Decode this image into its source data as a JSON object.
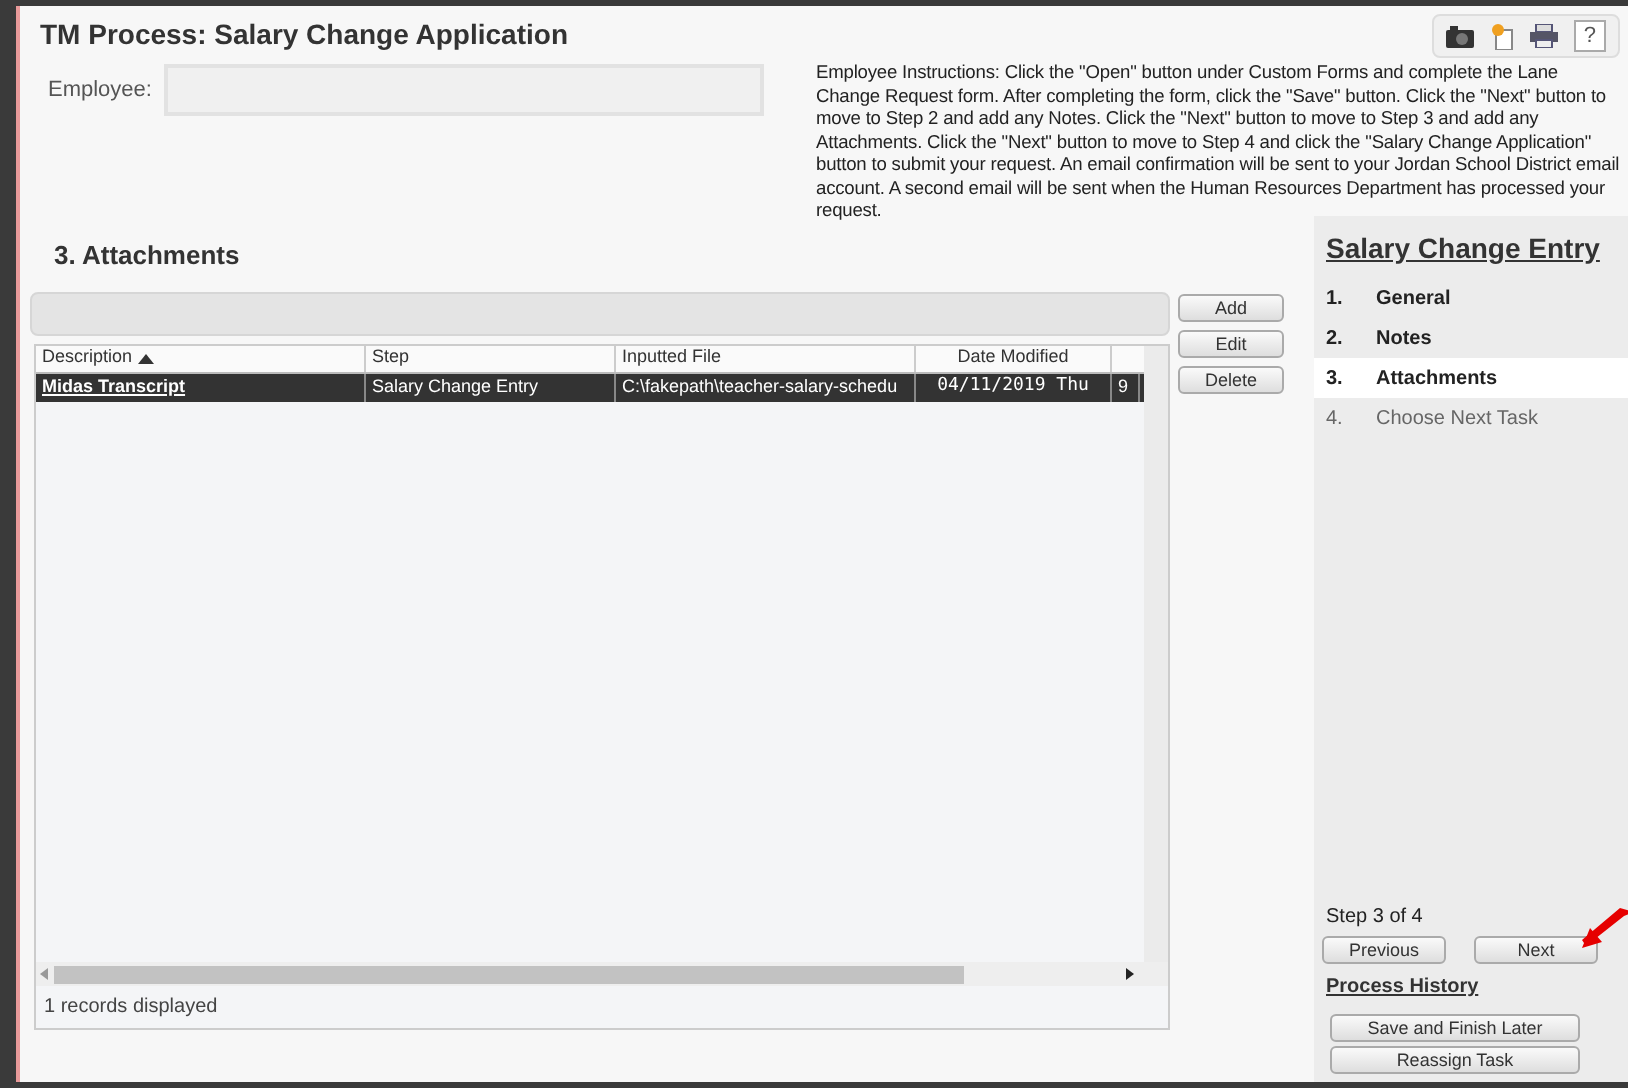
{
  "window": {
    "title": "TM Process: Salary Change Application"
  },
  "help_label": "?",
  "employee": {
    "label": "Employee:"
  },
  "instructions": "Employee Instructions: Click the \"Open\" button under Custom Forms and complete the Lane Change Request form. After completing the form, click the \"Save\" button. Click the \"Next\" button to move to Step 2 and add any Notes. Click the \"Next\" button to move to Step 3 and add any Attachments. Click the \"Next\" button to move to Step 4 and click the \"Salary Change Application\" button to submit your request. An email confirmation will be sent to your Jordan School District email account. A second email will be sent when the Human Resources Department has processed your request.",
  "section_title": "3. Attachments",
  "table": {
    "columns": [
      {
        "label": "Description",
        "sorted": true
      },
      {
        "label": "Step",
        "sorted": false
      },
      {
        "label": "Inputted File",
        "sorted": false
      },
      {
        "label": "Date Modified",
        "sorted": false
      }
    ],
    "rows": [
      {
        "cells": [
          "Midas Transcript",
          "Salary Change Entry",
          "C:\\fakepath\\teacher-salary-schedu",
          "04/11/2019 Thu",
          "9"
        ],
        "selected": true
      }
    ],
    "footer": "1 records displayed"
  },
  "side_buttons": [
    "Add",
    "Edit",
    "Delete"
  ],
  "steps_panel": {
    "title": "Salary Change Entry",
    "steps": [
      {
        "number": "1.",
        "label": "General",
        "selected": false,
        "disabled": false
      },
      {
        "number": "2.",
        "label": "Notes",
        "selected": false,
        "disabled": false
      },
      {
        "number": "3.",
        "label": "Attachments",
        "selected": true,
        "disabled": false
      },
      {
        "number": "4.",
        "label": "Choose Next Task",
        "selected": false,
        "disabled": true
      }
    ],
    "progress": "Step 3 of 4",
    "nav_buttons": [
      "Previous",
      "Next"
    ],
    "history_link": "Process History",
    "action_buttons": [
      "Save and Finish Later",
      "Reassign Task"
    ]
  }
}
